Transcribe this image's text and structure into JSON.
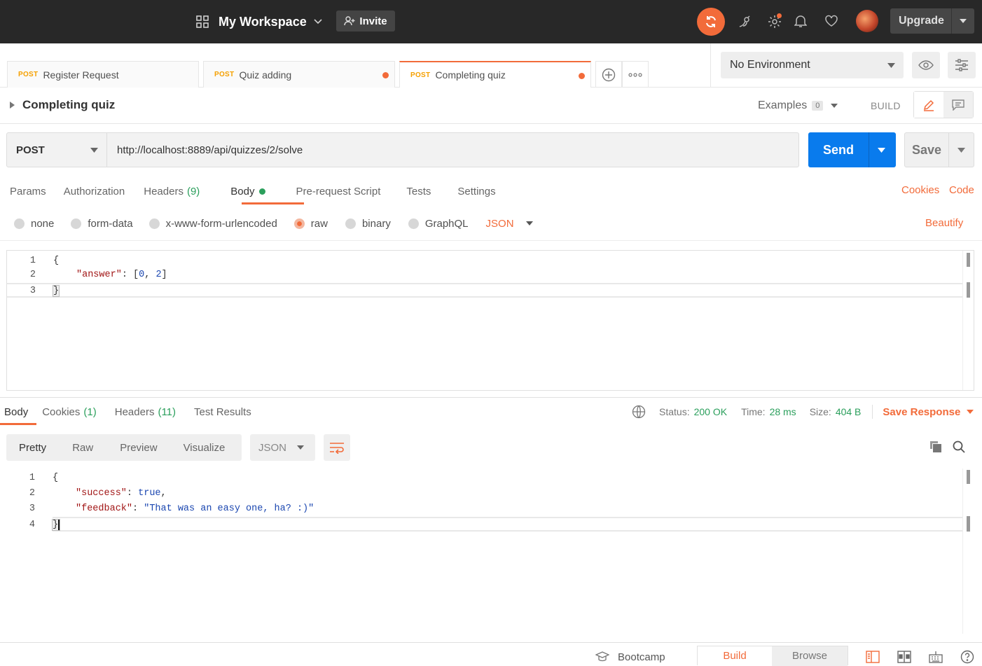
{
  "topbar": {
    "workspace": "My Workspace",
    "invite": "Invite",
    "upgrade": "Upgrade"
  },
  "tabs": [
    {
      "method": "POST",
      "name": "Register Request"
    },
    {
      "method": "POST",
      "name": "Quiz adding"
    },
    {
      "method": "POST",
      "name": "Completing quiz"
    }
  ],
  "environment": {
    "selected": "No Environment"
  },
  "request": {
    "title": "Completing quiz",
    "examples_label": "Examples",
    "examples_count": "0",
    "build_label": "BUILD",
    "method": "POST",
    "url": "http://localhost:8889/api/quizzes/2/solve",
    "send": "Send",
    "save": "Save",
    "tabs": [
      "Params",
      "Authorization",
      "Headers",
      "Body",
      "Pre-request Script",
      "Tests",
      "Settings"
    ],
    "headers_count": "(9)",
    "cookies_link": "Cookies",
    "code_link": "Code",
    "body_options": [
      "none",
      "form-data",
      "x-www-form-urlencoded",
      "raw",
      "binary",
      "GraphQL"
    ],
    "body_format": "JSON",
    "beautify": "Beautify",
    "body_lines": [
      {
        "n": "1",
        "text": "{"
      },
      {
        "n": "2",
        "key": "\"answer\"",
        "sep": ": [",
        "a": "0",
        ", ": ", ",
        "b": "2",
        "end": "]"
      },
      {
        "n": "3",
        "text": "}"
      }
    ]
  },
  "response": {
    "tabs": {
      "body": "Body",
      "cookies": "Cookies",
      "cookies_count": "(1)",
      "headers": "Headers",
      "headers_count": "(11)",
      "tests": "Test Results"
    },
    "status_label": "Status:",
    "status": "200 OK",
    "time_label": "Time:",
    "time": "28 ms",
    "size_label": "Size:",
    "size": "404 B",
    "save_response": "Save Response",
    "views": [
      "Pretty",
      "Raw",
      "Preview",
      "Visualize"
    ],
    "format": "JSON",
    "lines": [
      {
        "n": "1",
        "text": "{"
      },
      {
        "n": "2",
        "key": "\"success\"",
        "sep": ": ",
        "value": "true",
        "end": ","
      },
      {
        "n": "3",
        "key": "\"feedback\"",
        "sep": ": ",
        "value": "\"That was an easy one, ha? :)\"",
        "end": ""
      },
      {
        "n": "4",
        "text": "}"
      }
    ]
  },
  "statusbar": {
    "bootcamp": "Bootcamp",
    "build": "Build",
    "browse": "Browse"
  },
  "colors": {
    "accent": "#f26b3a",
    "send": "#097bed",
    "topbar": "#282828",
    "success": "#2b9f5c"
  }
}
